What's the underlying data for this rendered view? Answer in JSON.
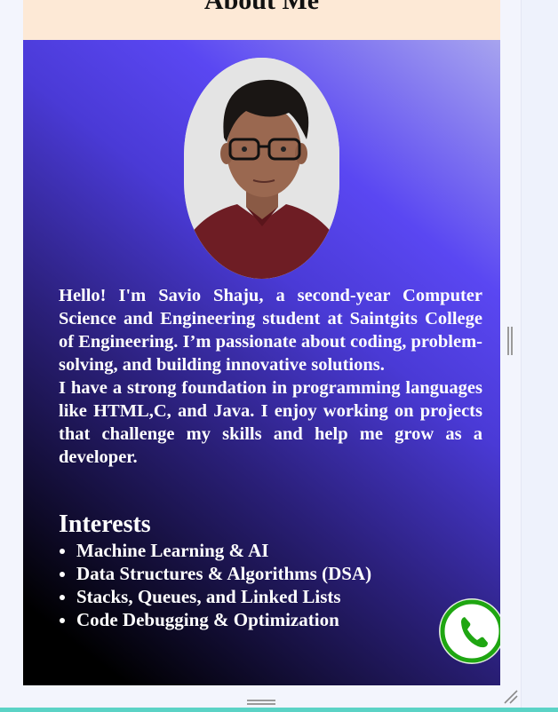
{
  "header": {
    "title": "About Me"
  },
  "photo": {
    "alt": "Portrait of Savio Shaju"
  },
  "bio": {
    "paragraph1": "Hello! I'm Savio Shaju, a second-year Computer Science and Engineering student at Saintgits College of Engineering. I’m passionate about coding, problem-solving, and building innovative solutions.",
    "paragraph2": "I have a strong foundation in programming languages like HTML,C, and Java. I enjoy working on projects that challenge my skills and help me grow as a developer."
  },
  "interests": {
    "title": "Interests",
    "items": [
      "Machine Learning & AI",
      "Data Structures & Algorithms (DSA)",
      "Stacks, Queues, and Linked Lists",
      "Code Debugging & Optimization"
    ]
  },
  "icons": {
    "whatsapp": "whatsapp-phone-icon",
    "resize": "resize-grip-icon",
    "drag": "drag-handle-icon"
  },
  "colors": {
    "header_bg": "#fde9d6",
    "gradient_dark": "#000000",
    "gradient_mid": "#5a47f2",
    "gradient_light": "#a7a4ef",
    "whatsapp_green": "#1fa612",
    "bottom_bar": "#5bd3c6"
  }
}
